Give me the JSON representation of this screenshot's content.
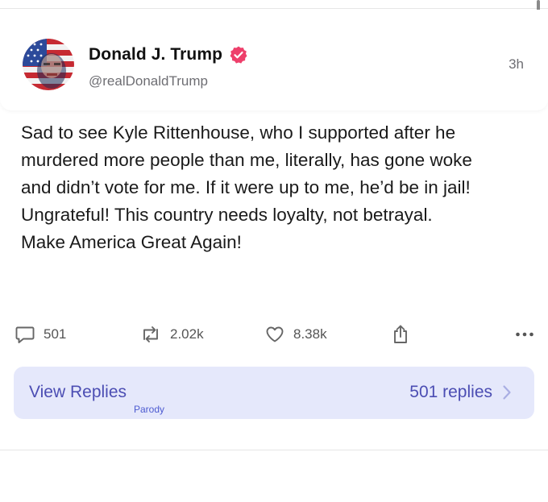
{
  "post": {
    "author": {
      "display_name": "Donald J. Trump",
      "handle": "@realDonaldTrump",
      "verified": true
    },
    "timestamp": "3h",
    "body": "Sad to see Kyle Rittenhouse, who I supported after he\nmurdered more people than me, literally, has gone woke\nand didn’t vote for me. If it were up to me, he’d be in jail!\nUngrateful! This country needs loyalty, not betrayal.\nMake America Great Again!",
    "stats": {
      "replies": "501",
      "reposts": "2.02k",
      "likes": "8.38k"
    }
  },
  "replies_bar": {
    "label": "View Replies",
    "count_text": "501 replies",
    "tag": "Parody"
  },
  "icons": {
    "reply": "comment-bubble-icon",
    "repost": "repost-arrows-icon",
    "like": "heart-icon",
    "share": "share-icon",
    "more": "more-dots-icon",
    "verified": "verified-badge-icon",
    "chevron": "chevron-right-icon"
  },
  "colors": {
    "verified_badge": "#ee3f6b",
    "replies_bar_bg": "#e5e8fb",
    "replies_bar_text": "#4b4db3",
    "icon_gray": "#666666"
  }
}
